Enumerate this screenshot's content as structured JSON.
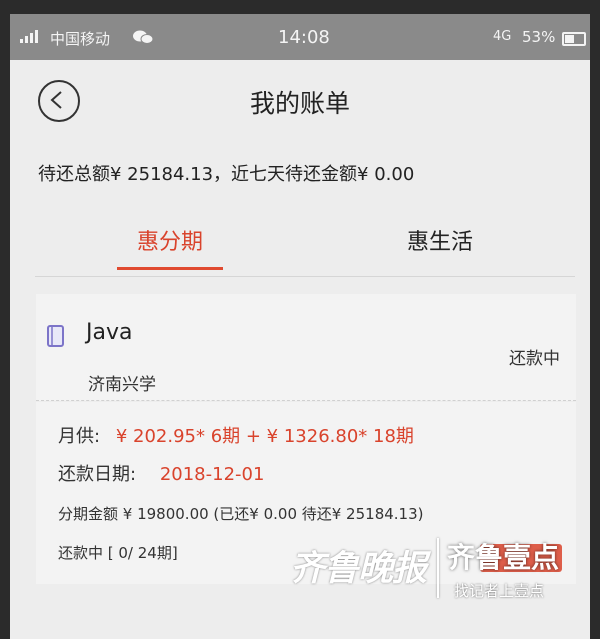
{
  "status_bar": {
    "carrier": "中国移动",
    "time": "14:08",
    "network": "4G",
    "battery": "53%"
  },
  "header": {
    "title": "我的账单"
  },
  "summary": {
    "text": "待还总额¥ 25184.13，近七天待还金额¥ 0.00"
  },
  "tabs": [
    {
      "label": "惠分期",
      "active": true
    },
    {
      "label": "惠生活",
      "active": false
    }
  ],
  "bill": {
    "course": "Java",
    "school": "济南兴学",
    "status": "还款中",
    "monthly_label": "月供:",
    "monthly_value": "¥ 202.95* 6期 + ¥ 1326.80* 18期",
    "date_label": "还款日期:",
    "date_value": "2018-12-01",
    "amount_text": "分期金额 ¥ 19800.00 (已还¥ 0.00 待还¥ 25184.13)",
    "progress_text": "还款中 [ 0/ 24期]"
  },
  "watermark": {
    "main": "齐鲁晚报",
    "brand": "齐鲁壹点",
    "sub": "找记者上壹点"
  },
  "colors": {
    "accent": "#d9432c",
    "background": "#ededed",
    "status_bar": "#8a8a8a"
  }
}
